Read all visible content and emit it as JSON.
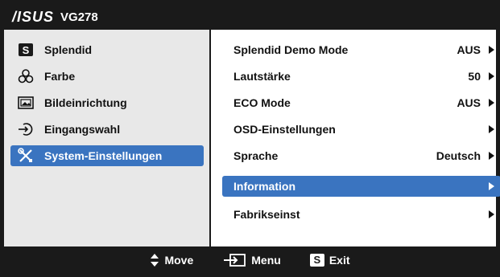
{
  "header": {
    "brand": "/ISUS",
    "model": "VG278"
  },
  "sidebar": {
    "items": [
      {
        "label": "Splendid",
        "icon": "splendid-s-icon"
      },
      {
        "label": "Farbe",
        "icon": "color-circles-icon"
      },
      {
        "label": "Bildeinrichtung",
        "icon": "picture-icon"
      },
      {
        "label": "Eingangswahl",
        "icon": "input-arrow-icon"
      },
      {
        "label": "System-Einstellungen",
        "icon": "wrench-screwdriver-icon",
        "selected": true
      }
    ],
    "splendid_badge": "S"
  },
  "options": {
    "items": [
      {
        "label": "Splendid Demo Mode",
        "value": "AUS"
      },
      {
        "label": "Lautstärke",
        "value": "50"
      },
      {
        "label": "ECO Mode",
        "value": "AUS"
      },
      {
        "label": "OSD-Einstellungen",
        "value": ""
      },
      {
        "label": "Sprache",
        "value": "Deutsch"
      },
      {
        "label": "Information",
        "value": "",
        "selected": true
      },
      {
        "label": "Fabrikseinst",
        "value": ""
      }
    ]
  },
  "footer": {
    "move_label": "Move",
    "menu_label": "Menu",
    "exit_label": "Exit",
    "exit_badge": "S"
  },
  "colors": {
    "frame": "#1a1a1a",
    "selection": "#3a74c0",
    "left_panel_bg": "#e8e8e8"
  }
}
